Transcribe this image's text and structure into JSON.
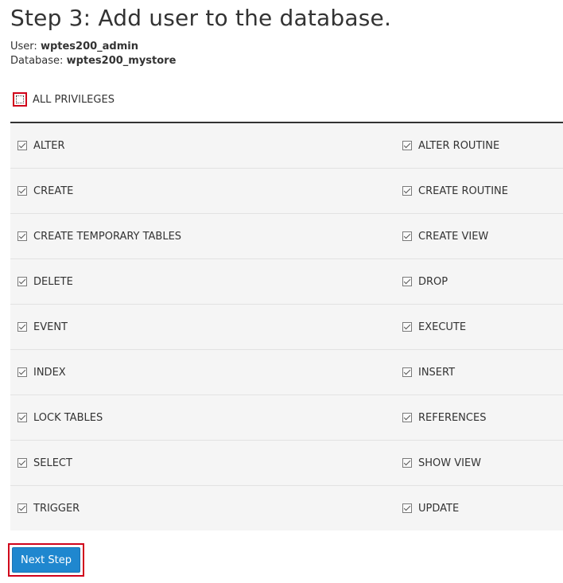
{
  "header": {
    "title": "Step 3: Add user to the database."
  },
  "meta": {
    "user_label": "User:",
    "user_value": "wptes200_admin",
    "database_label": "Database:",
    "database_value": "wptes200_mystore"
  },
  "all_privileges": {
    "label": "ALL PRIVILEGES",
    "checked": false
  },
  "privileges": {
    "rows": [
      {
        "left": "ALTER",
        "right": "ALTER ROUTINE"
      },
      {
        "left": "CREATE",
        "right": "CREATE ROUTINE"
      },
      {
        "left": "CREATE TEMPORARY TABLES",
        "right": "CREATE VIEW"
      },
      {
        "left": "DELETE",
        "right": "DROP"
      },
      {
        "left": "EVENT",
        "right": "EXECUTE"
      },
      {
        "left": "INDEX",
        "right": "INSERT"
      },
      {
        "left": "LOCK TABLES",
        "right": "REFERENCES"
      },
      {
        "left": "SELECT",
        "right": "SHOW VIEW"
      },
      {
        "left": "TRIGGER",
        "right": "UPDATE"
      }
    ]
  },
  "actions": {
    "next_label": "Next Step"
  },
  "colors": {
    "primary_button": "#1f87cf",
    "highlight_border": "#d0021b",
    "row_background": "#f5f5f5"
  }
}
